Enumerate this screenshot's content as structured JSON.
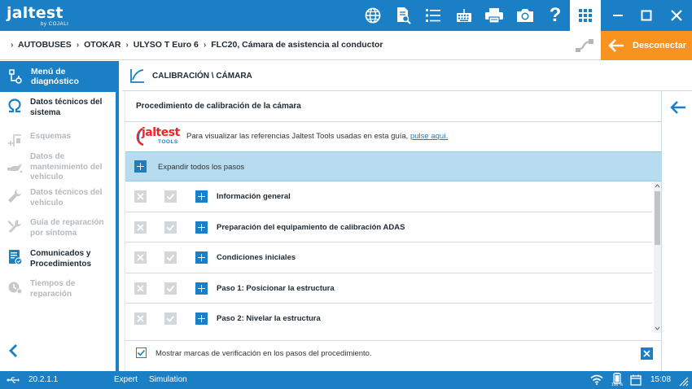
{
  "app": {
    "logo_text": "jaltest",
    "logo_sub": "by COJALI"
  },
  "toolbar": {
    "icons": [
      "globe-icon",
      "document-search-icon",
      "list-icon",
      "keyboard-icon",
      "printer-icon",
      "camera-icon",
      "help-icon",
      "apps-grid-icon"
    ],
    "help_label": "?"
  },
  "window": {
    "controls": [
      "minimize-icon",
      "maximize-icon",
      "close-icon"
    ]
  },
  "breadcrumb": {
    "items": [
      "AUTOBUSES",
      "OTOKAR",
      "ULYSO T Euro 6",
      "FLC20, Cámara de asistencia al conductor"
    ],
    "separator": "›"
  },
  "disconnect": {
    "label": "Desconectar"
  },
  "sidebar": {
    "header": "Menú de diagnóstico",
    "items": [
      {
        "label": "Datos técnicos del sistema",
        "icon": "omega-icon",
        "state": "active"
      },
      {
        "label": "Esquemas",
        "icon": "schematic-icon",
        "state": "disabled"
      },
      {
        "label": "Datos de mantenimiento del vehículo",
        "icon": "oil-can-icon",
        "state": "disabled"
      },
      {
        "label": "Datos técnicos del vehículo",
        "icon": "wrench-icon",
        "state": "disabled"
      },
      {
        "label": "Guía de reparación por síntoma",
        "icon": "tools-icon",
        "state": "disabled"
      },
      {
        "label": "Comunicados y Procedimientos",
        "icon": "bulletin-icon",
        "state": "active"
      },
      {
        "label": "Tiempos de reparación",
        "icon": "clock-gear-icon",
        "state": "disabled"
      }
    ]
  },
  "main": {
    "section_title": "CALIBRACIÓN \\ CÁMARA",
    "procedure_title": "Procedimiento de calibración de la cámara",
    "tools_logo_big": "jaltest",
    "tools_logo_small": "TOOLS",
    "tools_text": "Para visualizar las referencias Jaltest Tools usadas en esta guía,",
    "tools_link": "pulse aquí.",
    "expand_label": "Expandir todos los pasos",
    "steps": [
      {
        "label": "Información general"
      },
      {
        "label": "Preparación del equipamiento de calibración ADAS"
      },
      {
        "label": "Condiciones iniciales"
      },
      {
        "label": "Paso 1: Posicionar la estructura"
      },
      {
        "label": "Paso 2: Nivelar la estructura"
      }
    ],
    "show_checkmarks_label": "Mostrar marcas de verificación en los pasos del procedimiento.",
    "show_checkmarks_checked": true
  },
  "statusbar": {
    "version": "20.2.1.1",
    "mode": "Expert",
    "simulation": "Simulation",
    "battery": "100 %",
    "time": "15:08"
  },
  "colors": {
    "primary": "#1a7fc4",
    "accent": "#f7931e",
    "expand_bg": "#b7dcef",
    "disabled_text": "#b3b9be"
  }
}
